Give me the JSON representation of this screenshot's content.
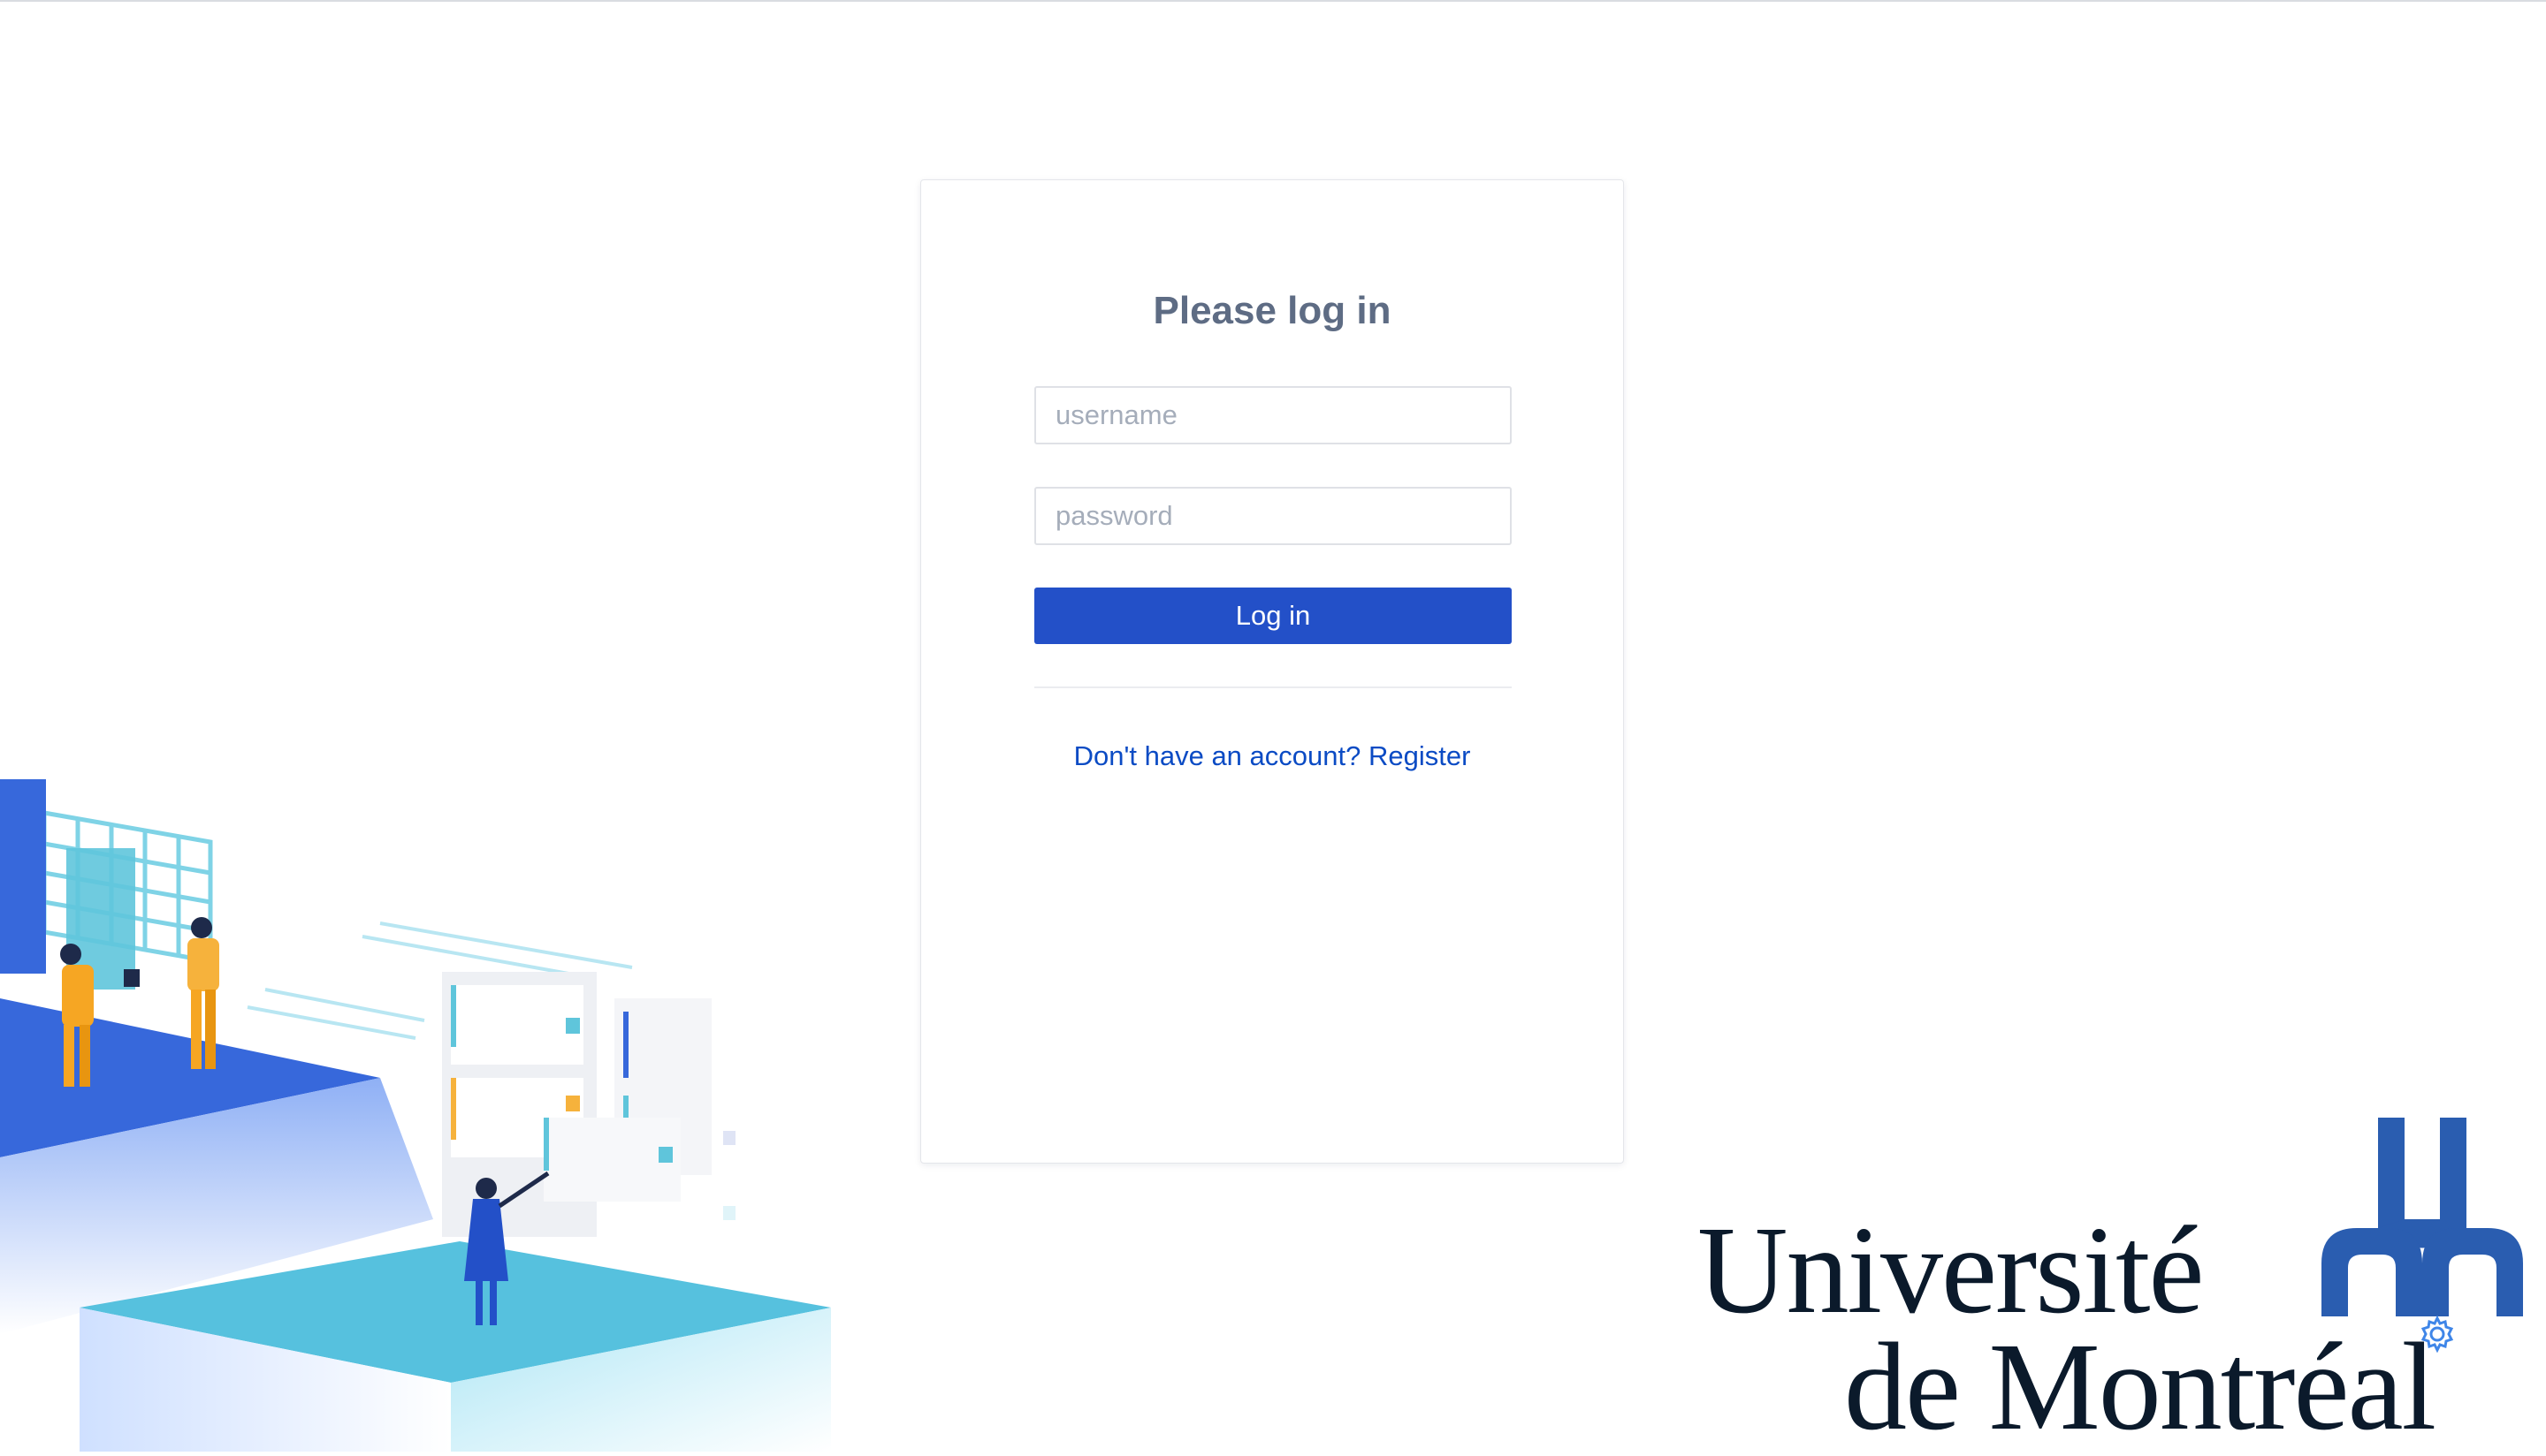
{
  "login": {
    "title": "Please log in",
    "username_placeholder": "username",
    "password_placeholder": "password",
    "submit_label": "Log in",
    "register_text": "Don't have an account? Register"
  },
  "branding": {
    "line1": "Université",
    "line2": "de Montréal"
  },
  "colors": {
    "primary": "#2350c8",
    "link": "#0b4bc4",
    "title": "#5e6c84",
    "logo_blue": "#2a5db0"
  },
  "icons": {
    "settings": "gear-icon"
  }
}
